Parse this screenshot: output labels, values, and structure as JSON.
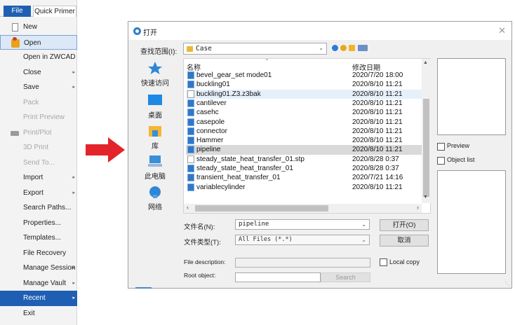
{
  "app_menu": {
    "tabs": {
      "file": "File",
      "quick_primer": "Quick Primer"
    },
    "items": [
      {
        "label": "New",
        "icon": "new-file-icon"
      },
      {
        "label": "Open",
        "icon": "open-folder-icon",
        "state": "selected"
      },
      {
        "label": "Open in ZWCAD"
      },
      {
        "label": "Close",
        "submenu": true
      },
      {
        "label": "Save",
        "submenu": true
      },
      {
        "label": "Pack",
        "state": "disabled"
      },
      {
        "label": "Print Preview",
        "state": "disabled"
      },
      {
        "label": "Print/Plot",
        "state": "disabled",
        "icon": "printer-icon"
      },
      {
        "label": "3D Print",
        "state": "disabled"
      },
      {
        "label": "Send To...",
        "state": "disabled"
      },
      {
        "label": "Import",
        "submenu": true
      },
      {
        "label": "Export",
        "submenu": true
      },
      {
        "label": "Search Paths..."
      },
      {
        "label": "Properties..."
      },
      {
        "label": "Templates..."
      },
      {
        "label": "File Recovery"
      },
      {
        "label": "Manage Session",
        "submenu": true
      },
      {
        "label": "Manage Vault",
        "submenu": true
      },
      {
        "label": "Recent",
        "submenu": true,
        "state": "highlighted"
      },
      {
        "label": "Exit"
      }
    ]
  },
  "dialog": {
    "title": "打开",
    "look_in_label": "查找范围(I):",
    "look_in_value": "Case",
    "places": [
      "快速访问",
      "桌面",
      "库",
      "此电脑",
      "网络"
    ],
    "columns": {
      "name": "名称",
      "date": "修改日期"
    },
    "files": [
      {
        "name": "bevel_gear_set mode01",
        "date": "2020/7/20 18:00",
        "icon": "part-file-icon"
      },
      {
        "name": "buckling01",
        "date": "2020/8/10 11:21",
        "icon": "part-file-icon"
      },
      {
        "name": "buckling01.Z3.z3bak",
        "date": "2020/8/10 11:21",
        "icon": "blank-file-icon",
        "state": "hover"
      },
      {
        "name": "cantilever",
        "date": "2020/8/10 11:21",
        "icon": "part-file-icon"
      },
      {
        "name": "casehc",
        "date": "2020/8/10 11:21",
        "icon": "part-file-icon"
      },
      {
        "name": "casepole",
        "date": "2020/8/10 11:21",
        "icon": "part-file-icon"
      },
      {
        "name": "connector",
        "date": "2020/8/10 11:21",
        "icon": "part-file-icon"
      },
      {
        "name": "Hammer",
        "date": "2020/8/10 11:21",
        "icon": "part-file-icon"
      },
      {
        "name": "pipeline",
        "date": "2020/8/10 11:21",
        "icon": "part-file-icon",
        "state": "selected"
      },
      {
        "name": "steady_state_heat_transfer_01.stp",
        "date": "2020/8/28 0:37",
        "icon": "blank-file-icon"
      },
      {
        "name": "steady_state_heat_transfer_01",
        "date": "2020/8/28 0:37",
        "icon": "part-file-icon"
      },
      {
        "name": "transient_heat_transfer_01",
        "date": "2020/7/21 14:16",
        "icon": "part-file-icon"
      },
      {
        "name": "variablecylinder",
        "date": "2020/8/10 11:21",
        "icon": "part-file-icon"
      }
    ],
    "filename_label": "文件名(N):",
    "filename_value": "pipeline",
    "filetype_label": "文件类型(T):",
    "filetype_value": "All Files (*.*)",
    "open_button": "打开(O)",
    "cancel_button": "取消",
    "file_description_label": "File description:",
    "root_object_label": "Root object:",
    "search_button": "Search",
    "local_copy_label": "Local copy",
    "preview_label": "Preview",
    "object_list_label": "Object list",
    "close_glyph": "✕"
  },
  "colors": {
    "accent_blue": "#1f5fb3",
    "arrow_red": "#e3242b",
    "selected_row": "#d9d9d9",
    "hover_row": "#e5f0fb"
  }
}
